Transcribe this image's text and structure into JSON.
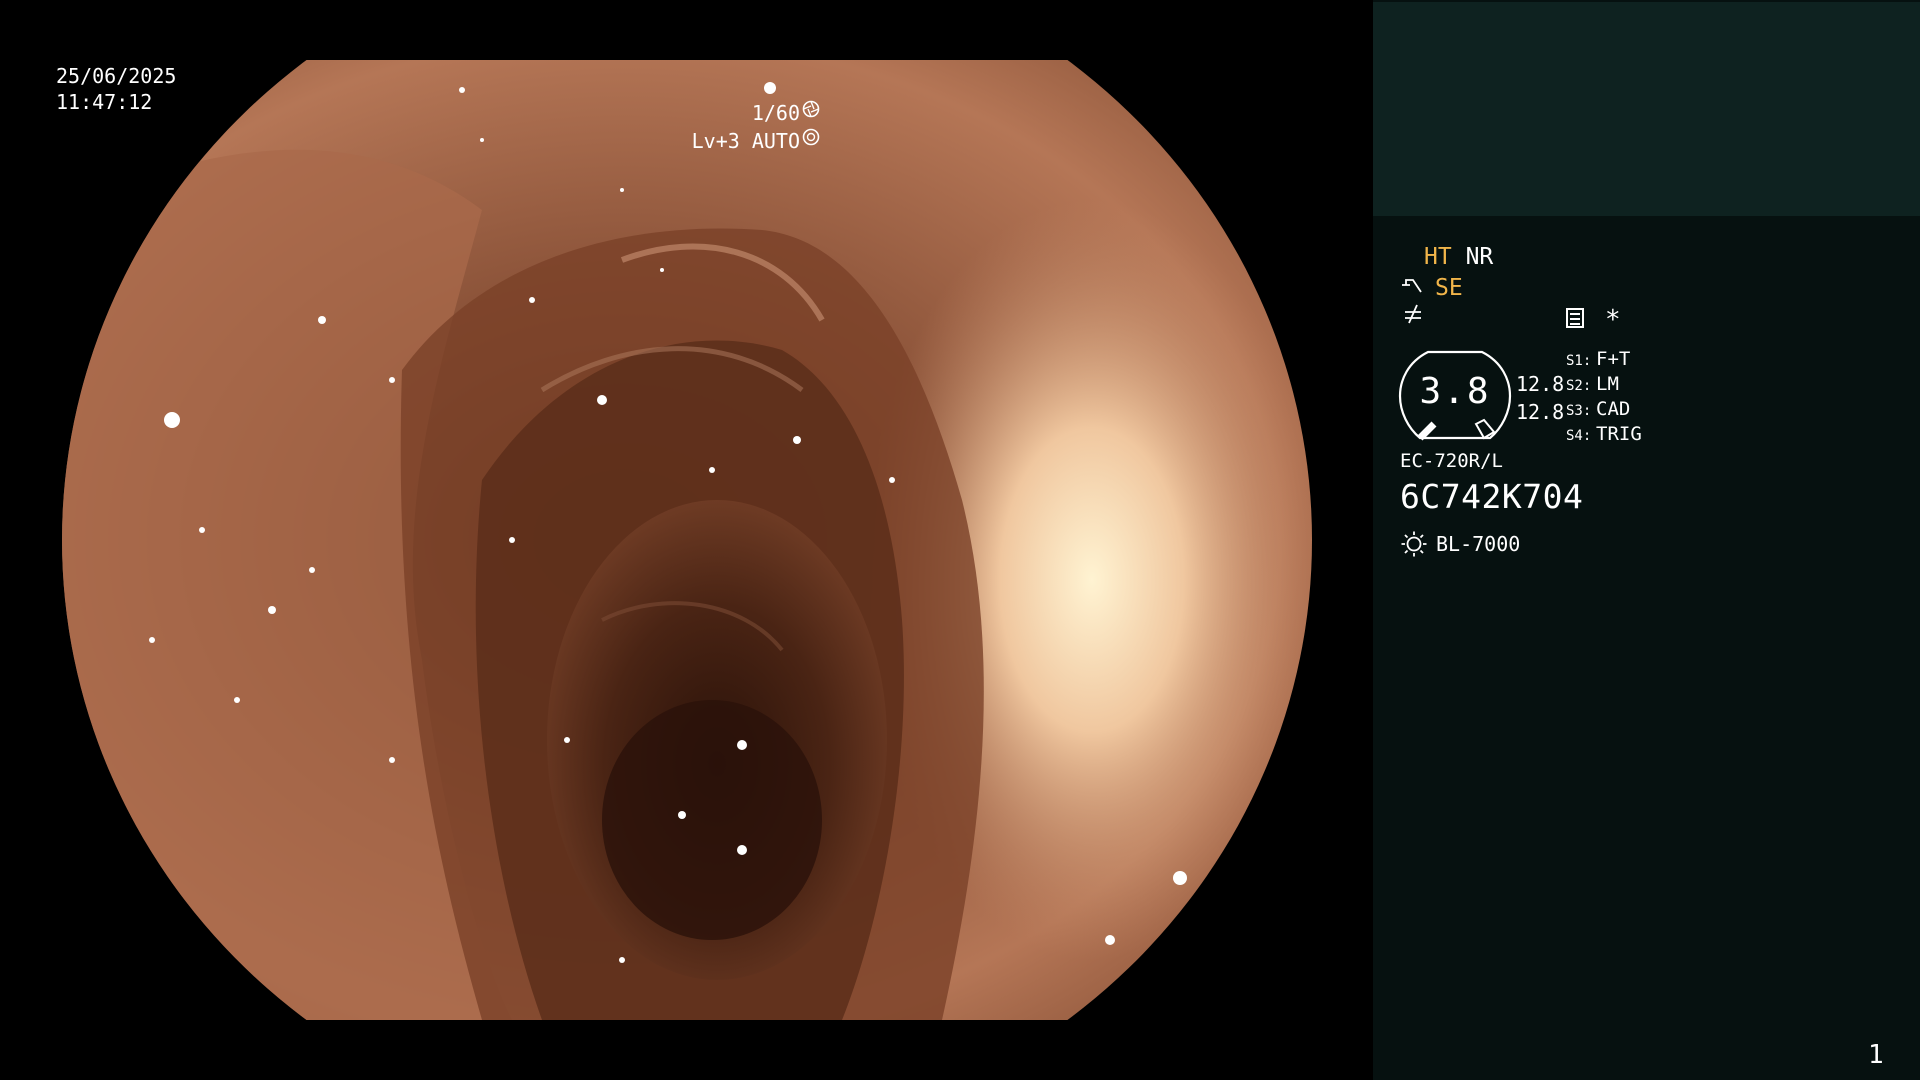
{
  "overlay": {
    "date": "25/06/2025",
    "time": "11:47:12",
    "shutter": "1/60",
    "shutter_icon": "aperture-icon",
    "level": "Lv+3 AUTO",
    "level_icon": "iris-icon"
  },
  "panel": {
    "enhancement": {
      "ht": "HT",
      "nr": "NR"
    },
    "structure": {
      "icon": "structure-enhance-icon",
      "label": "SE"
    },
    "no_connect_icon": "not-equal-icon",
    "filter_icon": "filter-icon",
    "asterisk": "*",
    "gauge": {
      "value": "3.8",
      "top": "12.8",
      "bottom": "12.8"
    },
    "switches": [
      {
        "key": "S1:",
        "value": "F+T"
      },
      {
        "key": "S2:",
        "value": "LM"
      },
      {
        "key": "S3:",
        "value": "CAD"
      },
      {
        "key": "S4:",
        "value": "TRIG"
      }
    ],
    "scope_model": "EC-720R/L",
    "serial": "6C742K704",
    "light_source": "BL-7000",
    "light_icon": "light-source-icon"
  },
  "page_number": "1",
  "colors": {
    "panel_bg": "#061110",
    "panel_top": "#0e2220",
    "highlight": "#f1b54a",
    "tissue": "#b9785a",
    "lumen": "#3a1c10"
  }
}
